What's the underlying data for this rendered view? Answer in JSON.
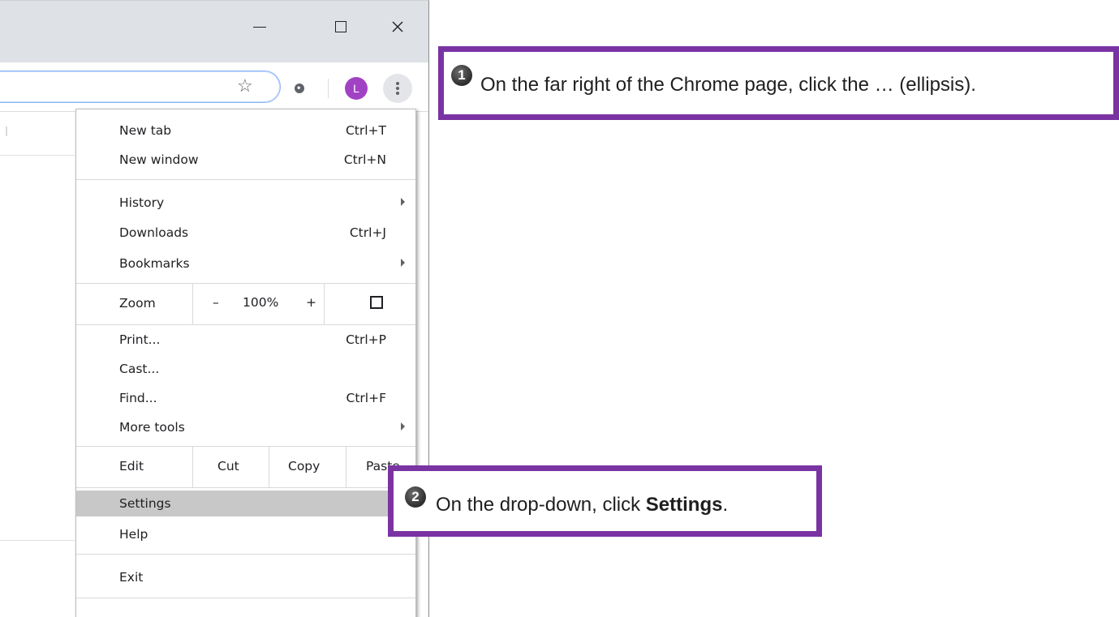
{
  "window": {
    "controls": {
      "minimize": "—",
      "maximize": "☐",
      "close": "✕"
    },
    "toolbar": {
      "star_icon": "star-icon",
      "extension_icon": "extension-icon",
      "profile_initial": "L",
      "menu_icon": "three-dot-menu-icon"
    }
  },
  "menu": {
    "new_tab": {
      "label": "New tab",
      "shortcut": "Ctrl+T"
    },
    "new_window": {
      "label": "New window",
      "shortcut": "Ctrl+N"
    },
    "history": {
      "label": "History"
    },
    "downloads": {
      "label": "Downloads",
      "shortcut": "Ctrl+J"
    },
    "bookmarks": {
      "label": "Bookmarks"
    },
    "zoom": {
      "label": "Zoom",
      "minus": "–",
      "value": "100%",
      "plus": "+"
    },
    "print": {
      "label": "Print...",
      "shortcut": "Ctrl+P"
    },
    "cast": {
      "label": "Cast..."
    },
    "find": {
      "label": "Find...",
      "shortcut": "Ctrl+F"
    },
    "more_tools": {
      "label": "More tools"
    },
    "edit": {
      "label": "Edit",
      "cut": "Cut",
      "copy": "Copy",
      "paste": "Paste"
    },
    "settings": {
      "label": "Settings"
    },
    "help": {
      "label": "Help"
    },
    "exit": {
      "label": "Exit"
    }
  },
  "callouts": {
    "step1": {
      "number": "1",
      "text": "On the far right of the Chrome page, click the … (ellipsis)."
    },
    "step2": {
      "number": "2",
      "text_before": "On the drop-down, click ",
      "text_bold": "Settings",
      "text_after": "."
    }
  },
  "colors": {
    "callout_border": "#7a33a3",
    "avatar": "#a142c4",
    "highlight": "#c8c8c8"
  }
}
